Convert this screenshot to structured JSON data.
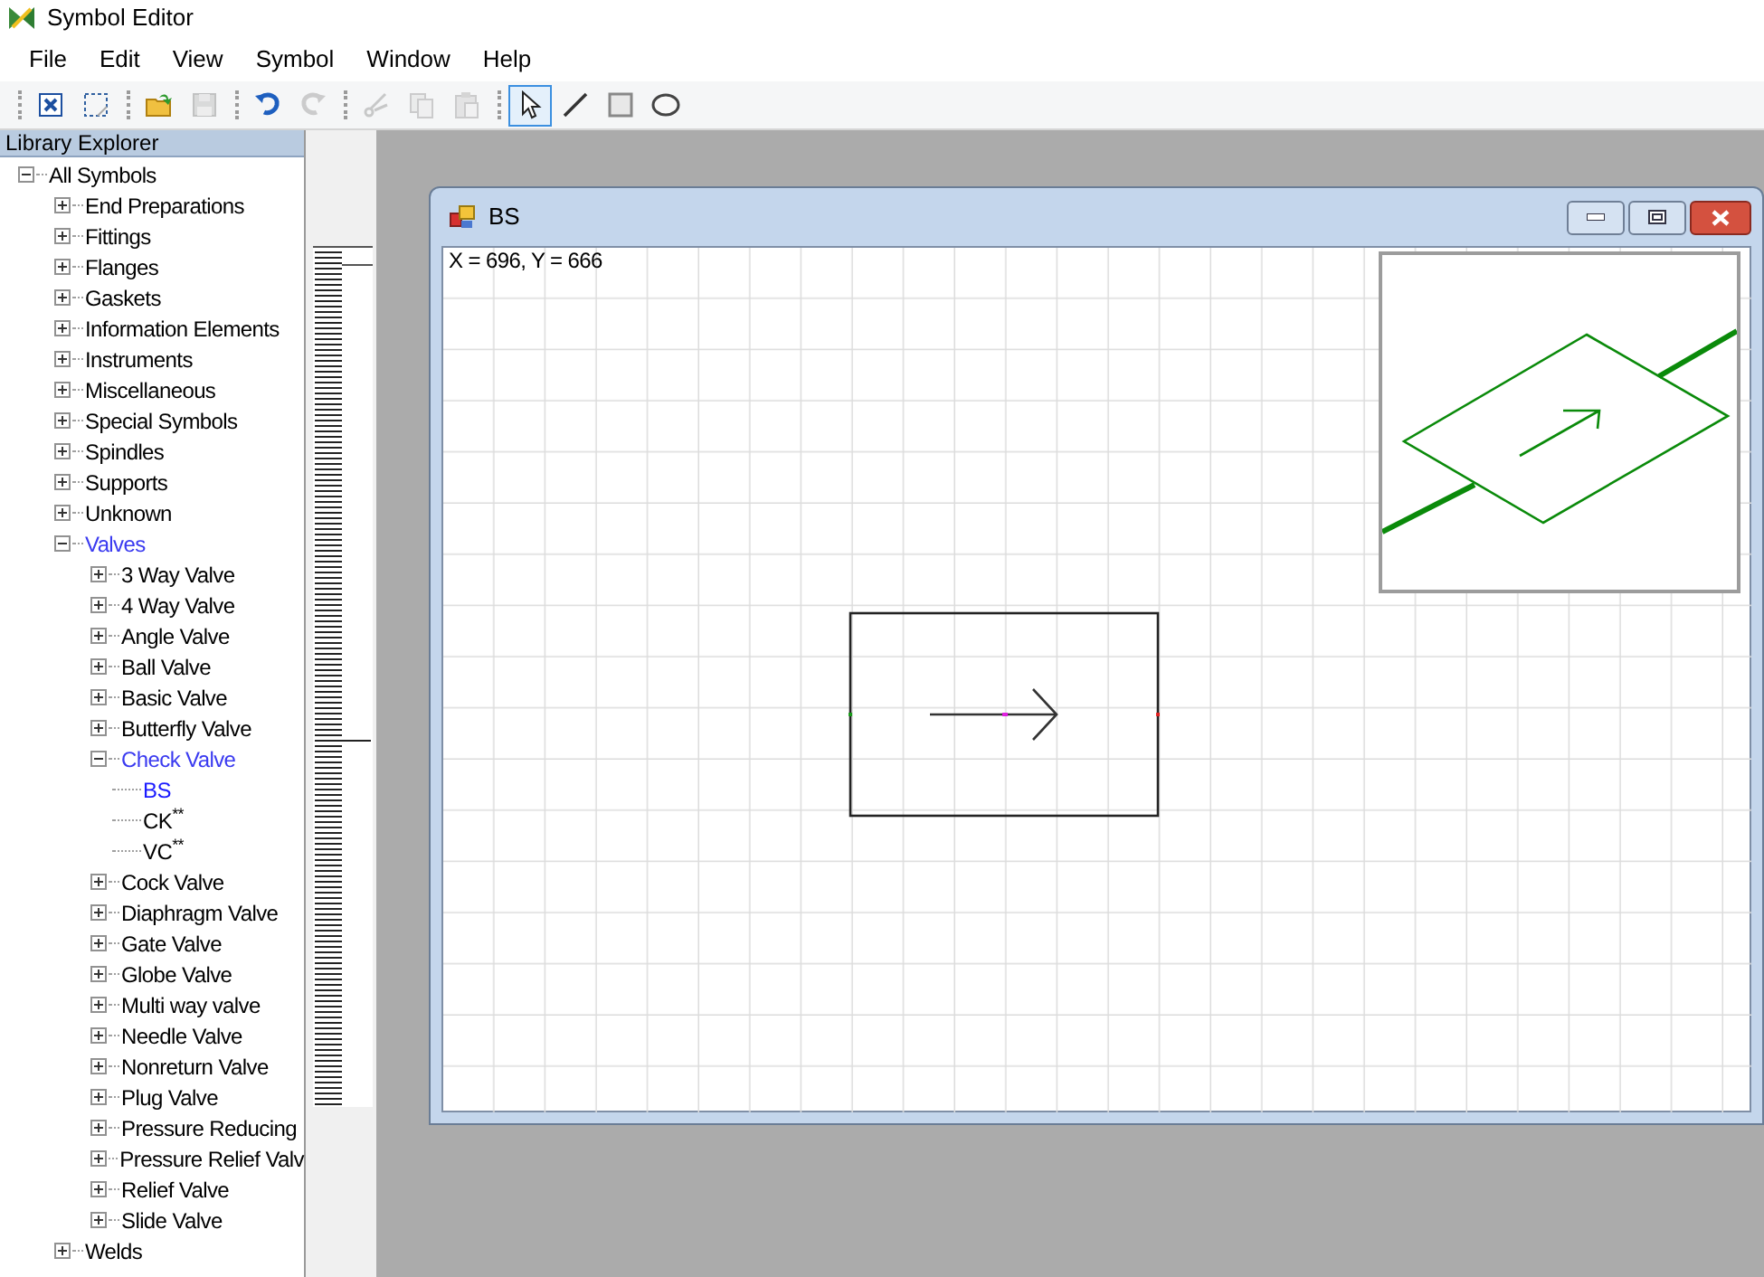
{
  "window": {
    "title": "Symbol Editor"
  },
  "menu": [
    "File",
    "Edit",
    "View",
    "Symbol",
    "Window",
    "Help"
  ],
  "toolbar_groups": [
    {
      "buttons": [
        {
          "kind": "fit",
          "disabled": false,
          "selected": false
        },
        {
          "kind": "select-area",
          "disabled": false,
          "selected": false
        }
      ]
    },
    {
      "buttons": [
        {
          "kind": "open",
          "disabled": false,
          "selected": false
        },
        {
          "kind": "save",
          "disabled": true,
          "selected": false
        }
      ]
    },
    {
      "buttons": [
        {
          "kind": "undo",
          "disabled": false,
          "selected": false
        },
        {
          "kind": "redo",
          "disabled": true,
          "selected": false
        }
      ]
    },
    {
      "buttons": [
        {
          "kind": "cut",
          "disabled": true,
          "selected": false
        },
        {
          "kind": "copy",
          "disabled": true,
          "selected": false
        },
        {
          "kind": "paste",
          "disabled": true,
          "selected": false
        }
      ]
    },
    {
      "buttons": [
        {
          "kind": "pointer",
          "disabled": false,
          "selected": true
        },
        {
          "kind": "line",
          "disabled": false,
          "selected": false
        },
        {
          "kind": "rectangle",
          "disabled": false,
          "selected": false
        },
        {
          "kind": "ellipse",
          "disabled": false,
          "selected": false
        }
      ]
    }
  ],
  "library_explorer": {
    "title": "Library Explorer",
    "tree": [
      {
        "label": "All Symbols",
        "kind": "folder",
        "expanded": true,
        "on_path": false,
        "selected": false,
        "children": [
          {
            "label": "End Preparations",
            "kind": "folder",
            "expanded": false,
            "on_path": false,
            "selected": false
          },
          {
            "label": "Fittings",
            "kind": "folder",
            "expanded": false,
            "on_path": false,
            "selected": false
          },
          {
            "label": "Flanges",
            "kind": "folder",
            "expanded": false,
            "on_path": false,
            "selected": false
          },
          {
            "label": "Gaskets",
            "kind": "folder",
            "expanded": false,
            "on_path": false,
            "selected": false
          },
          {
            "label": "Information Elements",
            "kind": "folder",
            "expanded": false,
            "on_path": false,
            "selected": false
          },
          {
            "label": "Instruments",
            "kind": "folder",
            "expanded": false,
            "on_path": false,
            "selected": false
          },
          {
            "label": "Miscellaneous",
            "kind": "folder",
            "expanded": false,
            "on_path": false,
            "selected": false
          },
          {
            "label": "Special Symbols",
            "kind": "folder",
            "expanded": false,
            "on_path": false,
            "selected": false
          },
          {
            "label": "Spindles",
            "kind": "folder",
            "expanded": false,
            "on_path": false,
            "selected": false
          },
          {
            "label": "Supports",
            "kind": "folder",
            "expanded": false,
            "on_path": false,
            "selected": false
          },
          {
            "label": "Unknown",
            "kind": "folder",
            "expanded": false,
            "on_path": false,
            "selected": false
          },
          {
            "label": "Valves",
            "kind": "folder",
            "expanded": true,
            "on_path": true,
            "selected": false,
            "children": [
              {
                "label": "3 Way Valve",
                "kind": "folder",
                "expanded": false,
                "on_path": false,
                "selected": false
              },
              {
                "label": "4 Way Valve",
                "kind": "folder",
                "expanded": false,
                "on_path": false,
                "selected": false
              },
              {
                "label": "Angle Valve",
                "kind": "folder",
                "expanded": false,
                "on_path": false,
                "selected": false
              },
              {
                "label": "Ball Valve",
                "kind": "folder",
                "expanded": false,
                "on_path": false,
                "selected": false
              },
              {
                "label": "Basic Valve",
                "kind": "folder",
                "expanded": false,
                "on_path": false,
                "selected": false
              },
              {
                "label": "Butterfly Valve",
                "kind": "folder",
                "expanded": false,
                "on_path": false,
                "selected": false
              },
              {
                "label": "Check Valve",
                "kind": "folder",
                "expanded": true,
                "on_path": true,
                "selected": false,
                "children": [
                  {
                    "label": "BS",
                    "kind": "leaf",
                    "selected": true
                  },
                  {
                    "label": "CK$^{**}$",
                    "kind": "leaf",
                    "selected": false
                  },
                  {
                    "label": "VC$^{**}$",
                    "kind": "leaf",
                    "selected": false
                  }
                ]
              },
              {
                "label": "Cock Valve",
                "kind": "folder",
                "expanded": false,
                "on_path": false,
                "selected": false
              },
              {
                "label": "Diaphragm Valve",
                "kind": "folder",
                "expanded": false,
                "on_path": false,
                "selected": false
              },
              {
                "label": "Gate Valve",
                "kind": "folder",
                "expanded": false,
                "on_path": false,
                "selected": false
              },
              {
                "label": "Globe Valve",
                "kind": "folder",
                "expanded": false,
                "on_path": false,
                "selected": false
              },
              {
                "label": "Multi way valve",
                "kind": "folder",
                "expanded": false,
                "on_path": false,
                "selected": false
              },
              {
                "label": "Needle Valve",
                "kind": "folder",
                "expanded": false,
                "on_path": false,
                "selected": false
              },
              {
                "label": "Nonreturn Valve",
                "kind": "folder",
                "expanded": false,
                "on_path": false,
                "selected": false
              },
              {
                "label": "Plug Valve",
                "kind": "folder",
                "expanded": false,
                "on_path": false,
                "selected": false
              },
              {
                "label": "Pressure Reducing",
                "kind": "folder",
                "expanded": false,
                "on_path": false,
                "selected": false
              },
              {
                "label": "Pressure Relief Valv",
                "kind": "folder",
                "expanded": false,
                "on_path": false,
                "selected": false
              },
              {
                "label": "Relief Valve",
                "kind": "folder",
                "expanded": false,
                "on_path": false,
                "selected": false
              },
              {
                "label": "Slide Valve",
                "kind": "folder",
                "expanded": false,
                "on_path": false,
                "selected": false
              }
            ]
          },
          {
            "label": "Welds",
            "kind": "folder",
            "expanded": false,
            "on_path": false,
            "selected": false
          }
        ]
      }
    ]
  },
  "symbol_window": {
    "title": "BS",
    "coordinates": "X = 696, Y = 666"
  }
}
